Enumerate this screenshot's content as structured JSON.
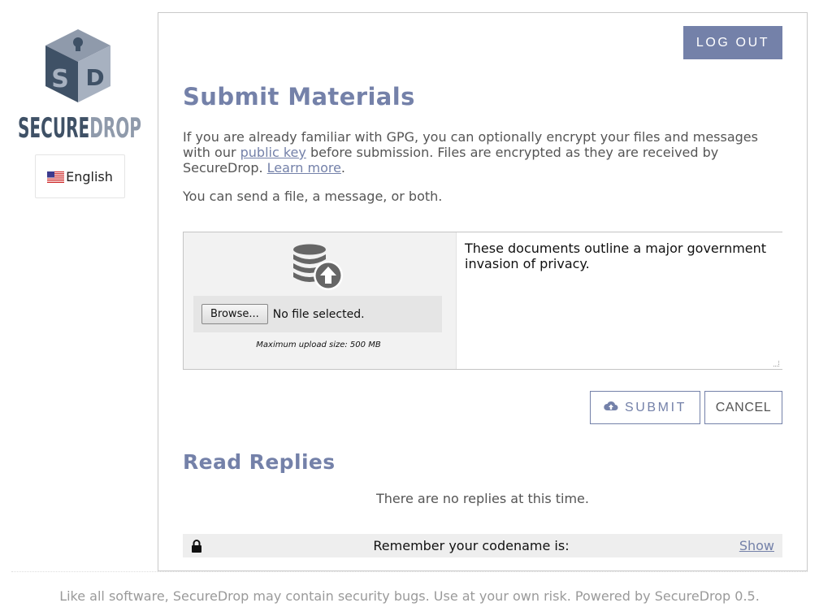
{
  "sidebar": {
    "logo_text": "SECUREDROP",
    "logo_text_parts": [
      "SECURE",
      "DROP"
    ],
    "logo_monogram": [
      "S",
      "D"
    ],
    "language": "English",
    "flag_icon": "us-flag-icon"
  },
  "header": {
    "logout_label": "LOG OUT"
  },
  "submit_section": {
    "title": "Submit Materials",
    "intro_before_link": "If you are already familiar with GPG, you can optionally encrypt your files and messages with our ",
    "public_key_link": "public key",
    "intro_middle": " before submission. Files are encrypted as they are received by SecureDrop. ",
    "learn_more_link": "Learn more",
    "intro_end": ".",
    "choice_text": "You can send a file, a message, or both.",
    "upload_icon": "database-upload-icon",
    "browse_label": "Browse...",
    "file_status": "No file selected.",
    "max_size": "Maximum upload size: 500 MB",
    "message_value": "These documents outline a major government invasion of privacy.",
    "submit_label": "SUBMIT",
    "submit_icon": "cloud-upload-icon",
    "cancel_label": "CANCEL"
  },
  "replies": {
    "title": "Read Replies",
    "empty_text": "There are no replies at this time."
  },
  "codename_bar": {
    "lock_icon": "lock-icon",
    "text": "Remember your codename is:",
    "show_label": "Show"
  },
  "footer": {
    "text": "Like all software, SecureDrop may contain security bugs. Use at your own risk. Powered by SecureDrop 0.5."
  },
  "colors": {
    "accent": "#7481a9",
    "logo_dark": "#3a4a5c",
    "logo_light": "#9aa6b8"
  }
}
